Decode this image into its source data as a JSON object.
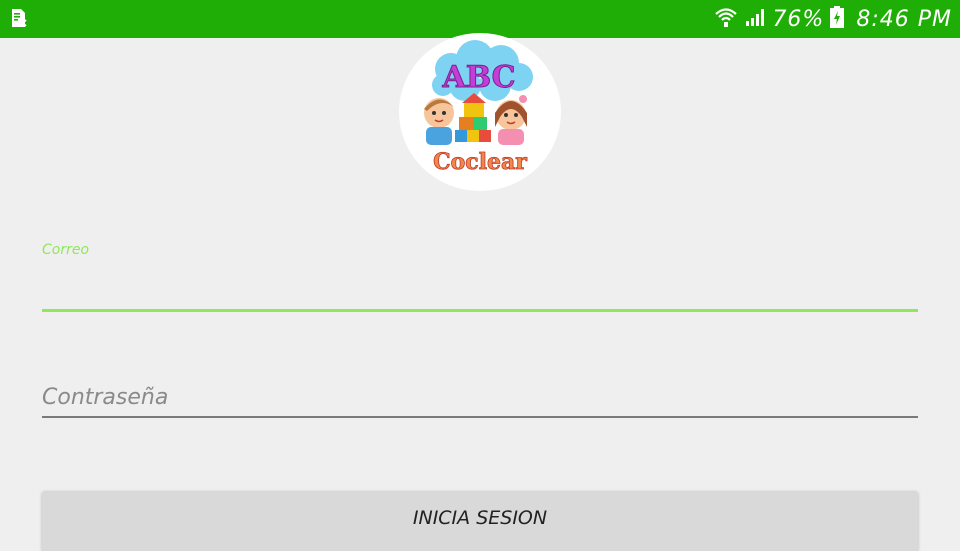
{
  "status_bar": {
    "battery_percent": "76%",
    "time": "8:46 PM",
    "background": "#1fae05",
    "icons": [
      "sim-card-icon",
      "wifi-icon",
      "signal-icon",
      "battery-charging-icon"
    ]
  },
  "logo": {
    "line1": "ABC",
    "line2": "Coclear"
  },
  "form": {
    "email_label": "Correo",
    "email_value": "",
    "password_placeholder": "Contraseña",
    "password_value": "",
    "accent_color": "#8ee85a"
  },
  "login_button": {
    "label": "INICIA SESION"
  }
}
